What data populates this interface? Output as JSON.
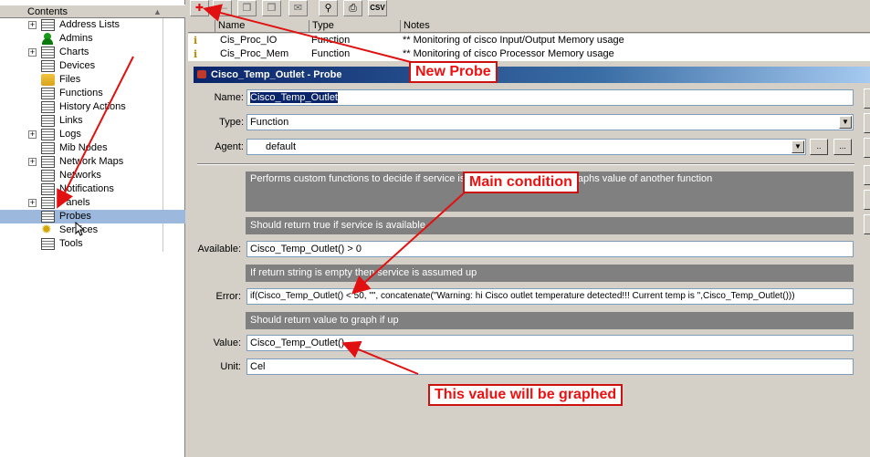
{
  "tree": {
    "header": "Contents",
    "items": [
      {
        "label": "Address Lists",
        "expand": "+",
        "icon": "table-icon"
      },
      {
        "label": "Admins",
        "expand": "",
        "icon": "admin-icon"
      },
      {
        "label": "Charts",
        "expand": "+",
        "icon": "table-icon"
      },
      {
        "label": "Devices",
        "expand": "",
        "icon": "table-icon"
      },
      {
        "label": "Files",
        "expand": "",
        "icon": "folder-icon"
      },
      {
        "label": "Functions",
        "expand": "",
        "icon": "table-icon"
      },
      {
        "label": "History Actions",
        "expand": "",
        "icon": "table-icon"
      },
      {
        "label": "Links",
        "expand": "",
        "icon": "table-icon"
      },
      {
        "label": "Logs",
        "expand": "+",
        "icon": "table-icon"
      },
      {
        "label": "Mib Nodes",
        "expand": "",
        "icon": "table-icon"
      },
      {
        "label": "Network Maps",
        "expand": "+",
        "icon": "table-icon"
      },
      {
        "label": "Networks",
        "expand": "",
        "icon": "table-icon"
      },
      {
        "label": "Notifications",
        "expand": "",
        "icon": "table-icon"
      },
      {
        "label": "Panels",
        "expand": "+",
        "icon": "table-icon"
      },
      {
        "label": "Probes",
        "expand": "",
        "icon": "table-icon",
        "selected": true
      },
      {
        "label": "Services",
        "expand": "",
        "icon": "gear-icon"
      },
      {
        "label": "Tools",
        "expand": "",
        "icon": "table-icon"
      }
    ]
  },
  "toolbar": {
    "add": "✚",
    "remove": "—",
    "copy": "❐",
    "paste": "❒",
    "comment": "✉",
    "find": "⚲",
    "print": "⎙",
    "csv": "CSV"
  },
  "list": {
    "columns": [
      "Name",
      "Type",
      "Notes"
    ],
    "rows": [
      {
        "name": "Cis_Proc_IO",
        "type": "Function",
        "notes": "** Monitoring of cisco Input/Output Memory usage"
      },
      {
        "name": "Cis_Proc_Mem",
        "type": "Function",
        "notes": "** Monitoring of cisco Processor Memory usage"
      }
    ]
  },
  "dialog": {
    "title": "Cisco_Temp_Outlet - Probe",
    "labels": {
      "name": "Name:",
      "type": "Type:",
      "agent": "Agent:",
      "available": "Available:",
      "error": "Error:",
      "value": "Value:",
      "unit": "Unit:"
    },
    "name": "Cisco_Temp_Outlet",
    "type": "Function",
    "agent": "default",
    "agent_btn1": "..",
    "agent_btn2": "...",
    "desc_main": "Performs custom functions to decide if service is available and up. If up graphs value of another function",
    "desc_available": "Should return true if service is available",
    "available": "Cisco_Temp_Outlet() > 0",
    "desc_error": "If return string is empty then service is assumed up",
    "error": "if(Cisco_Temp_Outlet() < 50, \"\", concatenate(\"Warning: hi Cisco outlet temperature detected!!! Current temp is \",Cisco_Temp_Outlet()))",
    "desc_value": "Should return value to graph if up",
    "value": "Cisco_Temp_Outlet()",
    "unit": "Cel"
  },
  "annotations": {
    "new_probe": "New Probe",
    "main_condition": "Main condition",
    "graphed": "This value will be graphed"
  },
  "colors": {
    "annotation": "#e11111",
    "selection": "#9cb8dd",
    "title_bar": "#0a246a"
  }
}
